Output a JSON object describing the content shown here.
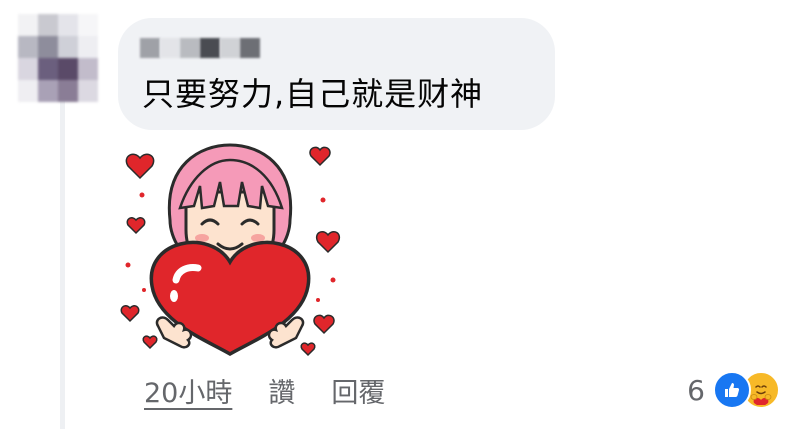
{
  "comment": {
    "author_name": "",
    "text": "只要努力,自己就是财神"
  },
  "sticker": {
    "name": "girl-hugging-heart-sticker"
  },
  "actions": {
    "time": "20小時",
    "like": "讚",
    "reply": "回覆"
  },
  "reactions": {
    "count": "6",
    "icons": [
      "like-icon",
      "care-icon"
    ]
  },
  "colors": {
    "bubble": "#f0f2f5",
    "text": "#050505",
    "secondary_text": "#65676b",
    "like_blue": "#1877f2",
    "care_yellow": "#f7b928",
    "heart_red": "#e0262b",
    "hair_pink": "#f59ab8"
  }
}
